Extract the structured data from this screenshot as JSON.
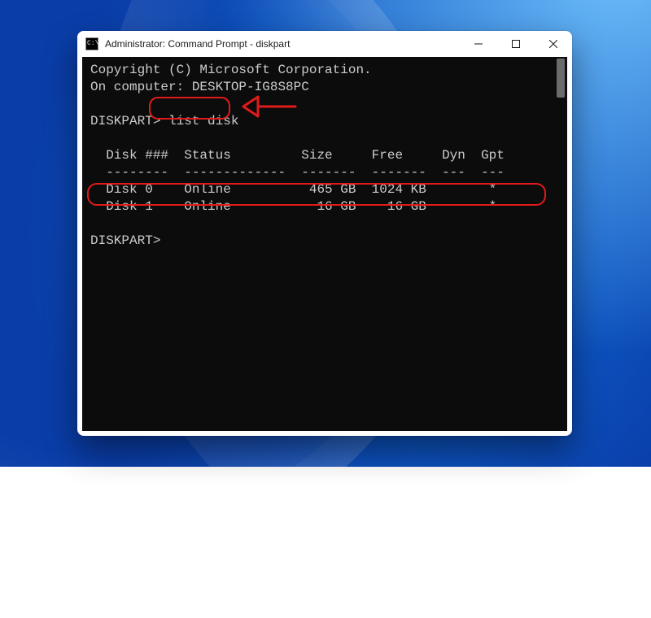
{
  "window": {
    "title": "Administrator: Command Prompt - diskpart"
  },
  "term": {
    "copyright": "Copyright (C) Microsoft Corporation.",
    "oncomputer": "On computer: DESKTOP-IG8S8PC",
    "blank": "",
    "prompt1": "DISKPART> ",
    "cmd1": "list disk",
    "hdr": "  Disk ###  Status         Size     Free     Dyn  Gpt",
    "rule": "  --------  -------------  -------  -------  ---  ---",
    "row0": "  Disk 0    Online          465 GB  1024 KB        *",
    "row1": "  Disk 1    Online           16 GB    16 GB        *",
    "prompt2": "DISKPART>"
  },
  "controls": {
    "minimize_title": "Minimize",
    "maximize_title": "Maximize",
    "close_title": "Close"
  }
}
